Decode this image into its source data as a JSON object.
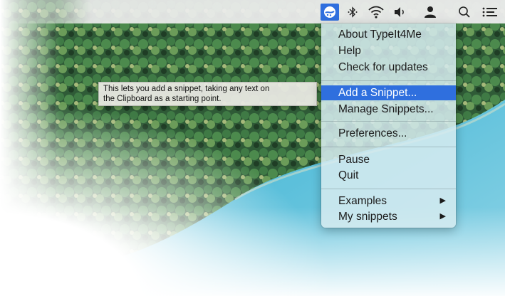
{
  "menubar": {
    "icons": [
      "typeit4me-icon",
      "bluetooth-icon",
      "wifi-icon",
      "volume-icon",
      "user-icon",
      "search-icon",
      "notification-list-icon"
    ]
  },
  "menu": {
    "items": [
      {
        "label": "About TypeIt4Me"
      },
      {
        "label": "Help"
      },
      {
        "label": "Check for updates"
      },
      {
        "label": "Add a Snippet..."
      },
      {
        "label": "Manage Snippets..."
      },
      {
        "label": "Preferences..."
      },
      {
        "label": "Pause"
      },
      {
        "label": "Quit"
      },
      {
        "label": "Examples",
        "submenu_arrow": "▶"
      },
      {
        "label": "My snippets",
        "submenu_arrow": "▶"
      }
    ],
    "selected": "Add a Snippet...",
    "accent_color": "#2f6fde"
  },
  "tooltip": {
    "line1": "This lets you add a snippet, taking any text on",
    "line2": "the Clipboard as a starting point."
  }
}
